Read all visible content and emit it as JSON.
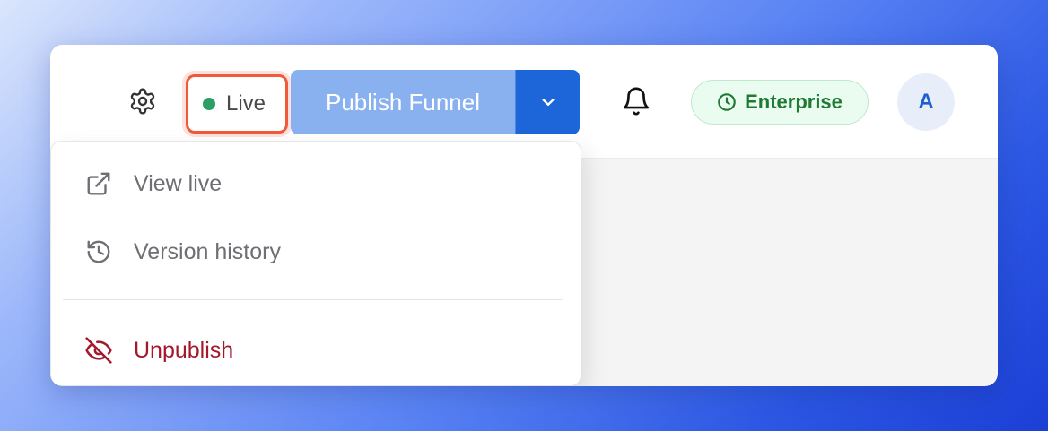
{
  "toolbar": {
    "settings_icon": "gear-icon",
    "status": {
      "label": "Live",
      "dot_color": "#2e9f63",
      "highlight_color": "#f05a3c"
    },
    "publish": {
      "label": "Publish Funnel",
      "main_color": "#89b1f0",
      "caret_color": "#1d66da",
      "caret_icon": "chevron-down-icon"
    },
    "notifications_icon": "bell-icon",
    "plan": {
      "label": "Enterprise",
      "icon": "clock-icon",
      "text_color": "#1f7a33"
    },
    "avatar": {
      "initial": "A"
    }
  },
  "dropdown": {
    "items": [
      {
        "label": "View live",
        "icon": "external-link-icon"
      },
      {
        "label": "Version history",
        "icon": "history-icon"
      }
    ],
    "danger_item": {
      "label": "Unpublish",
      "icon": "eye-off-icon",
      "color": "#a3182b"
    }
  }
}
